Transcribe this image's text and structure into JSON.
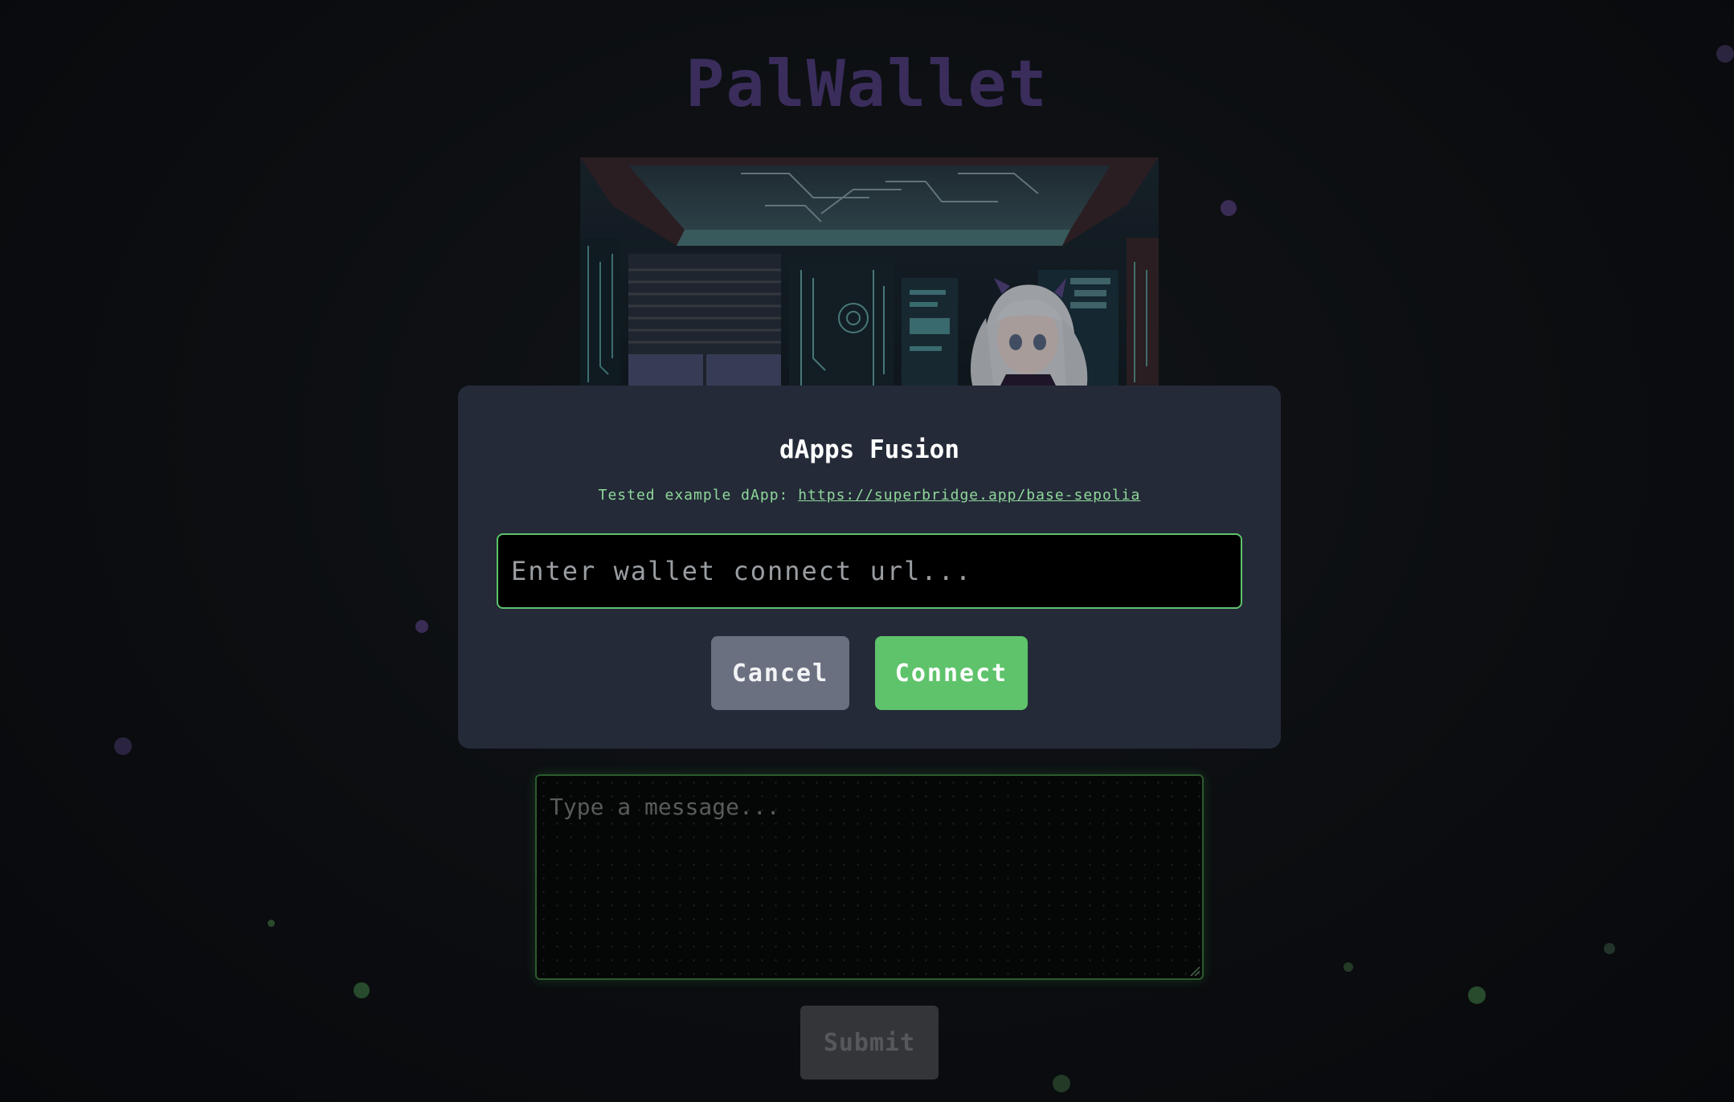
{
  "app": {
    "title": "PalWallet"
  },
  "hero": {
    "alt": "anime-girl-in-cyber-room-image"
  },
  "modal": {
    "title": "dApps Fusion",
    "hint_prefix": "Tested example dApp:",
    "hint_link": "https://superbridge.app/base-sepolia",
    "url_placeholder": "Enter wallet connect url...",
    "url_value": "",
    "cancel_label": "Cancel",
    "connect_label": "Connect"
  },
  "chat": {
    "placeholder": "Type a message...",
    "submit_label": "Submit"
  },
  "colors": {
    "accent": "#5ec36b",
    "modal_bg": "#242a38",
    "title_color": "#3a2d5c"
  }
}
